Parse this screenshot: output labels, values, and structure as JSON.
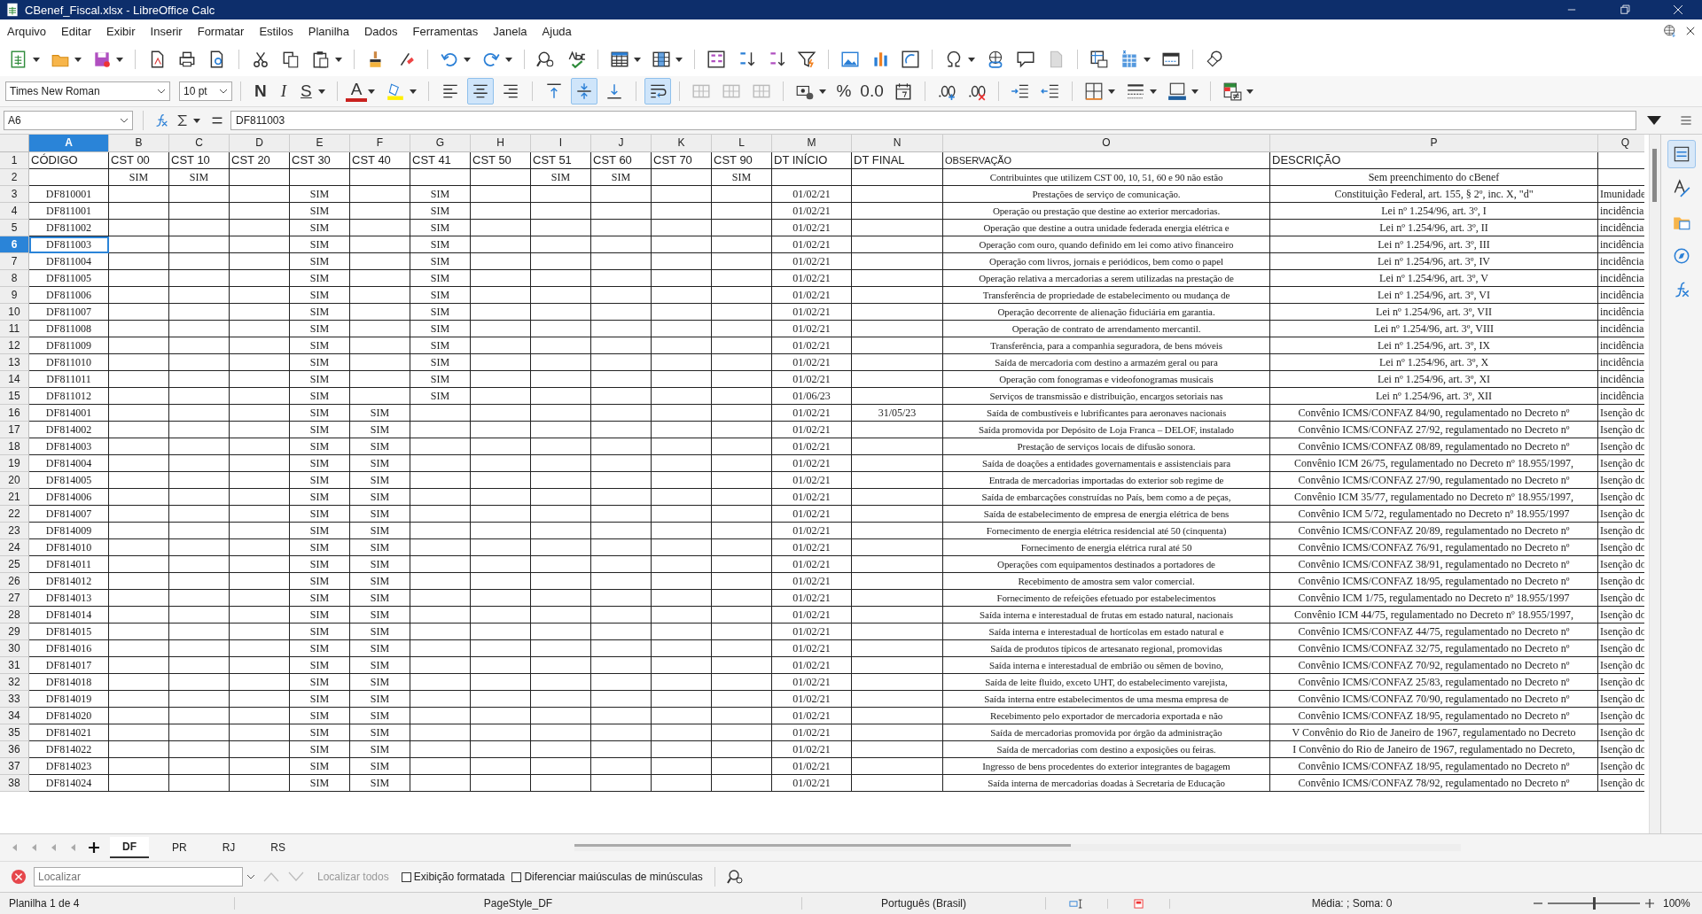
{
  "window": {
    "title": "CBenef_Fiscal.xlsx - LibreOffice Calc"
  },
  "menu": [
    "Arquivo",
    "Editar",
    "Exibir",
    "Inserir",
    "Formatar",
    "Estilos",
    "Planilha",
    "Dados",
    "Ferramentas",
    "Janela",
    "Ajuda"
  ],
  "format_toolbar": {
    "font_name": "Times New Roman",
    "font_size": "10 pt",
    "bold": "N",
    "italic": "I",
    "underline": "S",
    "font_color": "A",
    "percent": "%",
    "number_format": "0.0",
    "align_horizontal": [
      {
        "kind": "left",
        "selected": false
      },
      {
        "kind": "center",
        "selected": true
      },
      {
        "kind": "right",
        "selected": false
      }
    ],
    "align_vertical": [
      {
        "kind": "top",
        "selected": false
      },
      {
        "kind": "middle",
        "selected": true
      },
      {
        "kind": "bottom",
        "selected": false
      }
    ],
    "wrap_text": {
      "selected": true
    }
  },
  "formula_bar": {
    "name_box": "A6",
    "content": "DF811003"
  },
  "sheet": {
    "columns": [
      {
        "label": "A",
        "selected": true
      },
      {
        "label": "B",
        "selected": false
      },
      {
        "label": "C",
        "selected": false
      },
      {
        "label": "D",
        "selected": false
      },
      {
        "label": "E",
        "selected": false
      },
      {
        "label": "F",
        "selected": false
      },
      {
        "label": "G",
        "selected": false
      },
      {
        "label": "H",
        "selected": false
      },
      {
        "label": "I",
        "selected": false
      },
      {
        "label": "J",
        "selected": false
      },
      {
        "label": "K",
        "selected": false
      },
      {
        "label": "L",
        "selected": false
      },
      {
        "label": "M",
        "selected": false
      },
      {
        "label": "N",
        "selected": false
      },
      {
        "label": "O",
        "selected": false
      },
      {
        "label": "P",
        "selected": false
      },
      {
        "label": "Q",
        "selected": false
      }
    ],
    "rows": [
      {
        "number": "1",
        "kind": "header",
        "selected": false,
        "cells": {
          "A": "CÓDIGO",
          "B": "CST 00",
          "C": "CST 10",
          "D": "CST 20",
          "E": "CST 30",
          "F": "CST 40",
          "G": "CST 41",
          "H": "CST 50",
          "I": "CST 51",
          "J": "CST 60",
          "K": "CST 70",
          "L": "CST 90",
          "M": "DT INÍCIO",
          "N": "DT FINAL",
          "O": "OBSERVAÇÃO",
          "P": "DESCRIÇÃO"
        }
      },
      {
        "number": "2",
        "kind": "data",
        "selected": false,
        "cells": {
          "B": "SIM",
          "C": "SIM",
          "I": "SIM",
          "J": "SIM",
          "L": "SIM",
          "O": "Contribuintes que utilizem CST 00, 10, 51, 60 e 90 não estão",
          "P": "Sem preenchimento do cBenef"
        }
      },
      {
        "number": "3",
        "kind": "data",
        "selected": false,
        "cells": {
          "A": "DF810001",
          "E": "SIM",
          "G": "SIM",
          "M": "01/02/21",
          "O": "Prestações de serviço de comunicação.",
          "P": "Constituição Federal, art. 155, § 2º, inc. X, \"d\"",
          "Q": "Imunidade"
        }
      },
      {
        "number": "4",
        "kind": "data",
        "selected": false,
        "cells": {
          "A": "DF811001",
          "E": "SIM",
          "G": "SIM",
          "M": "01/02/21",
          "O": "Operação ou prestação que destine ao exterior mercadorias.",
          "P": "Lei nº 1.254/96, art. 3º, I",
          "Q": "incidência"
        }
      },
      {
        "number": "5",
        "kind": "data",
        "selected": false,
        "cells": {
          "A": "DF811002",
          "E": "SIM",
          "G": "SIM",
          "M": "01/02/21",
          "O": "Operação que destine a outra unidade federada energia elétrica e",
          "P": "Lei nº 1.254/96, art. 3º, II",
          "Q": "incidência"
        }
      },
      {
        "number": "6",
        "kind": "data",
        "selected": true,
        "cells": {
          "A": "DF811003",
          "E": "SIM",
          "G": "SIM",
          "M": "01/02/21",
          "O": "Operação com ouro, quando definido em lei como ativo financeiro",
          "P": "Lei nº 1.254/96, art. 3º, III",
          "Q": "incidência"
        }
      },
      {
        "number": "7",
        "kind": "data",
        "selected": false,
        "cells": {
          "A": "DF811004",
          "E": "SIM",
          "G": "SIM",
          "M": "01/02/21",
          "O": "Operação com livros, jornais e periódicos, bem como o papel",
          "P": "Lei nº 1.254/96, art. 3º, IV",
          "Q": "incidência"
        }
      },
      {
        "number": "8",
        "kind": "data",
        "selected": false,
        "cells": {
          "A": "DF811005",
          "E": "SIM",
          "G": "SIM",
          "M": "01/02/21",
          "O": "Operação relativa a mercadorias a serem utilizadas na prestação de",
          "P": "Lei nº 1.254/96, art. 3º, V",
          "Q": "incidência"
        }
      },
      {
        "number": "9",
        "kind": "data",
        "selected": false,
        "cells": {
          "A": "DF811006",
          "E": "SIM",
          "G": "SIM",
          "M": "01/02/21",
          "O": "Transferência de propriedade de estabelecimento ou mudança de",
          "P": "Lei nº 1.254/96, art. 3º, VI",
          "Q": "incidência"
        }
      },
      {
        "number": "10",
        "kind": "data",
        "selected": false,
        "cells": {
          "A": "DF811007",
          "E": "SIM",
          "G": "SIM",
          "M": "01/02/21",
          "O": "Operação decorrente de alienação fiduciária em garantia.",
          "P": "Lei nº 1.254/96, art. 3º, VII",
          "Q": "incidência"
        }
      },
      {
        "number": "11",
        "kind": "data",
        "selected": false,
        "cells": {
          "A": "DF811008",
          "E": "SIM",
          "G": "SIM",
          "M": "01/02/21",
          "O": "Operação de contrato de arrendamento mercantil.",
          "P": "Lei nº 1.254/96, art. 3º, VIII",
          "Q": "incidência"
        }
      },
      {
        "number": "12",
        "kind": "data",
        "selected": false,
        "cells": {
          "A": "DF811009",
          "E": "SIM",
          "G": "SIM",
          "M": "01/02/21",
          "O": "Transferência, para a companhia seguradora, de bens móveis",
          "P": "Lei nº 1.254/96, art. 3º, IX",
          "Q": "incidência"
        }
      },
      {
        "number": "13",
        "kind": "data",
        "selected": false,
        "cells": {
          "A": "DF811010",
          "E": "SIM",
          "G": "SIM",
          "M": "01/02/21",
          "O": "Saída de mercadoria com destino a armazém geral ou para",
          "P": "Lei nº 1.254/96, art. 3º, X",
          "Q": "incidência"
        }
      },
      {
        "number": "14",
        "kind": "data",
        "selected": false,
        "cells": {
          "A": "DF811011",
          "E": "SIM",
          "G": "SIM",
          "M": "01/02/21",
          "O": "Operação com fonogramas e videofonogramas musicais",
          "P": "Lei nº 1.254/96, art. 3º, XI",
          "Q": "incidência"
        }
      },
      {
        "number": "15",
        "kind": "data",
        "selected": false,
        "cells": {
          "A": "DF811012",
          "E": "SIM",
          "G": "SIM",
          "M": "01/06/23",
          "O": "Serviços de transmissão e distribuição, encargos setoriais nas",
          "P": "Lei nº 1.254/96, art. 3º, XII",
          "Q": "incidência"
        }
      },
      {
        "number": "16",
        "kind": "data",
        "selected": false,
        "cells": {
          "A": "DF814001",
          "E": "SIM",
          "F": "SIM",
          "M": "01/02/21",
          "N": "31/05/23",
          "O": "Saída de combustíveis e lubrificantes para aeronaves nacionais",
          "P": "Convênio ICMS/CONFAZ 84/90, regulamentado no Decreto nº",
          "Q": "Isenção do"
        }
      },
      {
        "number": "17",
        "kind": "data",
        "selected": false,
        "cells": {
          "A": "DF814002",
          "E": "SIM",
          "F": "SIM",
          "M": "01/02/21",
          "O": "Saída promovida por Depósito de Loja Franca – DELOF, instalado",
          "P": "Convênio ICMS/CONFAZ 27/92, regulamentado no Decreto nº",
          "Q": "Isenção do"
        }
      },
      {
        "number": "18",
        "kind": "data",
        "selected": false,
        "cells": {
          "A": "DF814003",
          "E": "SIM",
          "F": "SIM",
          "M": "01/02/21",
          "O": "Prestação de serviços locais de difusão sonora.",
          "P": "Convênio ICMS/CONFAZ 08/89, regulamentado no Decreto nº",
          "Q": "Isenção do"
        }
      },
      {
        "number": "19",
        "kind": "data",
        "selected": false,
        "cells": {
          "A": "DF814004",
          "E": "SIM",
          "F": "SIM",
          "M": "01/02/21",
          "O": "Saída de doações a entidades governamentais e assistenciais para",
          "P": "Convênio ICM 26/75, regulamentado no Decreto nº 18.955/1997,",
          "Q": "Isenção do"
        }
      },
      {
        "number": "20",
        "kind": "data",
        "selected": false,
        "cells": {
          "A": "DF814005",
          "E": "SIM",
          "F": "SIM",
          "M": "01/02/21",
          "O": "Entrada de mercadorias importadas do exterior sob regime de",
          "P": "Convênio ICMS/CONFAZ 27/90, regulamentado no Decreto nº",
          "Q": "Isenção do"
        }
      },
      {
        "number": "21",
        "kind": "data",
        "selected": false,
        "cells": {
          "A": "DF814006",
          "E": "SIM",
          "F": "SIM",
          "M": "01/02/21",
          "O": "Saída de embarcações construídas no País, bem como a de peças,",
          "P": "Convênio ICM 35/77, regulamentado no Decreto nº 18.955/1997,",
          "Q": "Isenção do"
        }
      },
      {
        "number": "22",
        "kind": "data",
        "selected": false,
        "cells": {
          "A": "DF814007",
          "E": "SIM",
          "F": "SIM",
          "M": "01/02/21",
          "O": "Saída de estabelecimento de empresa de energia elétrica de bens",
          "P": "Convênio ICM 5/72, regulamentado no Decreto nº 18.955/1997",
          "Q": "Isenção do"
        }
      },
      {
        "number": "23",
        "kind": "data",
        "selected": false,
        "cells": {
          "A": "DF814009",
          "E": "SIM",
          "F": "SIM",
          "M": "01/02/21",
          "O": "Fornecimento de energia elétrica residencial até 50 (cinquenta)",
          "P": "Convênio ICMS/CONFAZ 20/89, regulamentado no Decreto nº",
          "Q": "Isenção do"
        }
      },
      {
        "number": "24",
        "kind": "data",
        "selected": false,
        "cells": {
          "A": "DF814010",
          "E": "SIM",
          "F": "SIM",
          "M": "01/02/21",
          "O": "Fornecimento de energia elétrica rural até 50",
          "P": "Convênio ICMS/CONFAZ 76/91, regulamentado no Decreto nº",
          "Q": "Isenção do"
        }
      },
      {
        "number": "25",
        "kind": "data",
        "selected": false,
        "cells": {
          "A": "DF814011",
          "E": "SIM",
          "F": "SIM",
          "M": "01/02/21",
          "O": "Operações com equipamentos destinados a portadores de",
          "P": "Convênio ICMS/CONFAZ 38/91, regulamentado no Decreto nº",
          "Q": "Isenção do"
        }
      },
      {
        "number": "26",
        "kind": "data",
        "selected": false,
        "cells": {
          "A": "DF814012",
          "E": "SIM",
          "F": "SIM",
          "M": "01/02/21",
          "O": "Recebimento de amostra sem valor comercial.",
          "P": "Convênio ICMS/CONFAZ 18/95, regulamentado no Decreto nº",
          "Q": "Isenção do"
        }
      },
      {
        "number": "27",
        "kind": "data",
        "selected": false,
        "cells": {
          "A": "DF814013",
          "E": "SIM",
          "F": "SIM",
          "M": "01/02/21",
          "O": "Fornecimento de refeições efetuado por estabelecimentos",
          "P": "Convênio ICM 1/75, regulamentado no Decreto nº 18.955/1997",
          "Q": "Isenção do"
        }
      },
      {
        "number": "28",
        "kind": "data",
        "selected": false,
        "cells": {
          "A": "DF814014",
          "E": "SIM",
          "F": "SIM",
          "M": "01/02/21",
          "O": "Saída interna e interestadual de frutas em estado natural, nacionais",
          "P": "Convênio ICM 44/75, regulamentado no Decreto nº 18.955/1997,",
          "Q": "Isenção do"
        }
      },
      {
        "number": "29",
        "kind": "data",
        "selected": false,
        "cells": {
          "A": "DF814015",
          "E": "SIM",
          "F": "SIM",
          "M": "01/02/21",
          "O": "Saída interna e interestadual de hortícolas em estado natural e",
          "P": "Convênio ICMS/CONFAZ 44/75, regulamentado no Decreto nº",
          "Q": "Isenção do"
        }
      },
      {
        "number": "30",
        "kind": "data",
        "selected": false,
        "cells": {
          "A": "DF814016",
          "E": "SIM",
          "F": "SIM",
          "M": "01/02/21",
          "O": "Saída de produtos típicos de artesanato regional, promovidas",
          "P": "Convênio ICMS/CONFAZ 32/75, regulamentado no Decreto nº",
          "Q": "Isenção do"
        }
      },
      {
        "number": "31",
        "kind": "data",
        "selected": false,
        "cells": {
          "A": "DF814017",
          "E": "SIM",
          "F": "SIM",
          "M": "01/02/21",
          "O": "Saída interna e interestadual de embrião ou sêmen de bovino,",
          "P": "Convênio ICMS/CONFAZ 70/92, regulamentado no Decreto nº",
          "Q": "Isenção do"
        }
      },
      {
        "number": "32",
        "kind": "data",
        "selected": false,
        "cells": {
          "A": "DF814018",
          "E": "SIM",
          "F": "SIM",
          "M": "01/02/21",
          "O": "Saída de leite fluido, exceto UHT, do estabelecimento varejista,",
          "P": "Convênio ICMS/CONFAZ 25/83, regulamentado no Decreto nº",
          "Q": "Isenção do"
        }
      },
      {
        "number": "33",
        "kind": "data",
        "selected": false,
        "cells": {
          "A": "DF814019",
          "E": "SIM",
          "F": "SIM",
          "M": "01/02/21",
          "O": "Saída interna entre estabelecimentos de uma mesma empresa de",
          "P": "Convênio ICMS/CONFAZ 70/90, regulamentado no Decreto nº",
          "Q": "Isenção do"
        }
      },
      {
        "number": "34",
        "kind": "data",
        "selected": false,
        "cells": {
          "A": "DF814020",
          "E": "SIM",
          "F": "SIM",
          "M": "01/02/21",
          "O": "Recebimento pelo exportador de mercadoria exportada e não",
          "P": "Convênio ICMS/CONFAZ 18/95, regulamentado no Decreto nº",
          "Q": "Isenção do"
        }
      },
      {
        "number": "35",
        "kind": "data",
        "selected": false,
        "cells": {
          "A": "DF814021",
          "E": "SIM",
          "F": "SIM",
          "M": "01/02/21",
          "O": "Saída de mercadorias promovida por órgão da administração",
          "P": "V Convênio do Rio de Janeiro de 1967, regulamentado no Decreto",
          "Q": "Isenção do"
        }
      },
      {
        "number": "36",
        "kind": "data",
        "selected": false,
        "cells": {
          "A": "DF814022",
          "E": "SIM",
          "F": "SIM",
          "M": "01/02/21",
          "O": "Saída de mercadorias com destino a exposições ou feiras.",
          "P": "I Convênio do Rio de Janeiro de 1967, regulamentado no Decreto,",
          "Q": "Isenção do"
        }
      },
      {
        "number": "37",
        "kind": "data",
        "selected": false,
        "cells": {
          "A": "DF814023",
          "E": "SIM",
          "F": "SIM",
          "M": "01/02/21",
          "O": "Ingresso de bens procedentes do exterior integrantes de bagagem",
          "P": "Convênio ICMS/CONFAZ 18/95, regulamentado no Decreto nº",
          "Q": "Isenção do"
        }
      },
      {
        "number": "38",
        "kind": "data",
        "selected": false,
        "cells": {
          "A": "DF814024",
          "E": "SIM",
          "F": "SIM",
          "M": "01/02/21",
          "O": "Saída interna de mercadorias doadas à Secretaria de Educação",
          "P": "Convênio ICMS/CONFAZ 78/92, regulamentado no Decreto nº",
          "Q": "Isenção do"
        }
      }
    ]
  },
  "sheet_tabs": [
    {
      "label": "DF",
      "selected": true
    },
    {
      "label": "PR",
      "selected": false
    },
    {
      "label": "RJ",
      "selected": false
    },
    {
      "label": "RS",
      "selected": false
    }
  ],
  "find_bar": {
    "placeholder": "Localizar",
    "find_all": "Localizar todos",
    "options": [
      {
        "label": "Exibição formatada",
        "checked": false
      },
      {
        "label": "Diferenciar maiúsculas de minúsculas",
        "checked": false
      }
    ]
  },
  "status_bar": {
    "sheet": "Planilha 1 de 4",
    "page_style": "PageStyle_DF",
    "language": "Português (Brasil)",
    "summary": "Média: ; Soma: 0",
    "zoom": {
      "level": 0.5,
      "reading": "100%"
    }
  }
}
